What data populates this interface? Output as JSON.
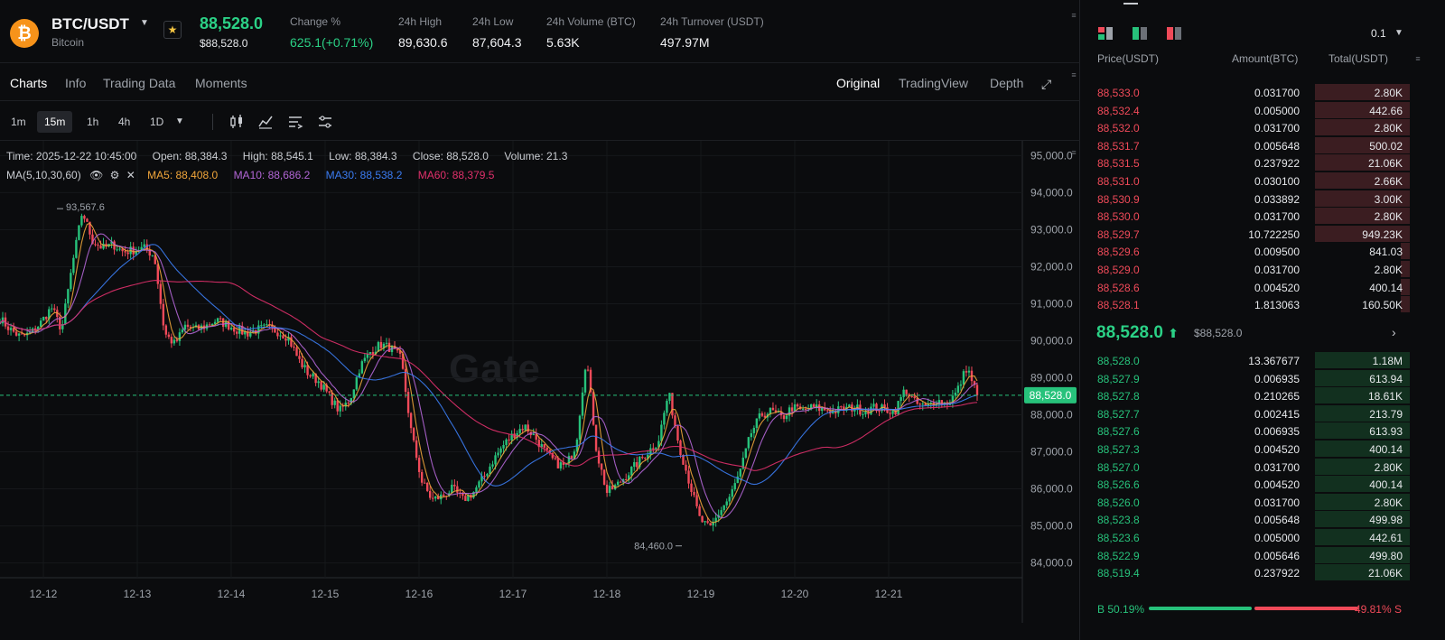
{
  "ticker": {
    "coin_glyph": "₿",
    "pair": "BTC/USDT",
    "name": "Bitcoin",
    "last_price": "88,528.0",
    "last_price_usd": "$88,528.0",
    "stats": [
      {
        "label": "Change %",
        "value": "625.1(+0.71%)",
        "color": "#2bd186"
      },
      {
        "label": "24h High",
        "value": "89,630.6"
      },
      {
        "label": "24h Low",
        "value": "87,604.3"
      },
      {
        "label": "24h Volume (BTC)",
        "value": "5.63K"
      },
      {
        "label": "24h Turnover (USDT)",
        "value": "497.97M"
      }
    ]
  },
  "tabs": {
    "left": [
      "Charts",
      "Info",
      "Trading Data",
      "Moments"
    ],
    "right": [
      "Original",
      "TradingView",
      "Depth"
    ]
  },
  "intervals": [
    "1m",
    "15m",
    "1h",
    "4h",
    "1D"
  ],
  "toolbar_icons": [
    "candlestick-icon",
    "indicator-icon",
    "settings-icon",
    "layout-icon"
  ],
  "chart_info": {
    "time": "Time: 2025-12-22 10:45:00",
    "open": "Open: 88,384.3",
    "high": "High: 88,545.1",
    "low": "Low: 88,384.3",
    "close": "Close: 88,528.0",
    "volume": "Volume: 21.3",
    "ma_label": "MA(5,10,30,60)",
    "ma5": "MA5: 88,408.0",
    "ma10": "MA10: 88,686.2",
    "ma30": "MA30: 88,538.2",
    "ma60": "MA60: 88,379.5"
  },
  "watermark": "Gate",
  "colors": {
    "up": "#27c27b",
    "down": "#f04a59",
    "ma5": "#f0a53a",
    "ma10": "#b266d6",
    "ma30": "#3b7cf2",
    "ma60": "#e0306b",
    "price_line": "#27c27b"
  },
  "chart_data": {
    "type": "candlestick",
    "ylim": [
      83600,
      95400
    ],
    "y_ticks": [
      95000,
      94000,
      93000,
      92000,
      91000,
      90000,
      89000,
      88000,
      87000,
      86000,
      85000,
      84000
    ],
    "y_tick_labels": [
      "95,000.0",
      "94,000.0",
      "93,000.0",
      "92,000.0",
      "91,000.0",
      "90,000.0",
      "89,000.0",
      "88,000.0",
      "87,000.0",
      "86,000.0",
      "85,000.0",
      "84,000.0"
    ],
    "x_tick_labels": [
      "12-12",
      "12-13",
      "12-14",
      "12-15",
      "12-16",
      "12-17",
      "12-18",
      "12-19",
      "12-20",
      "12-21"
    ],
    "current_price": 88528.0,
    "current_price_label": "88,528.0",
    "max_label": "93,567.6",
    "max_value": 93567.6,
    "min_label": "84,460.0",
    "min_value": 84460.0,
    "close_path": [
      {
        "date": "12-11",
        "price": 90600
      },
      {
        "date": "12-11",
        "price": 90300
      },
      {
        "date": "12-11",
        "price": 90100
      },
      {
        "date": "12-11",
        "price": 90200
      },
      {
        "date": "12-11",
        "price": 90500
      },
      {
        "date": "12-11",
        "price": 90900
      },
      {
        "date": "12-12",
        "price": 90300
      },
      {
        "date": "12-12",
        "price": 92000
      },
      {
        "date": "12-12",
        "price": 93500
      },
      {
        "date": "12-12",
        "price": 92700
      },
      {
        "date": "12-12",
        "price": 92500
      },
      {
        "date": "12-12",
        "price": 92600
      },
      {
        "date": "12-12",
        "price": 92400
      },
      {
        "date": "12-12",
        "price": 92450
      },
      {
        "date": "12-12",
        "price": 92500
      },
      {
        "date": "12-12",
        "price": 92300
      },
      {
        "date": "12-13",
        "price": 90200
      },
      {
        "date": "12-13",
        "price": 89900
      },
      {
        "date": "12-13",
        "price": 90400
      },
      {
        "date": "12-13",
        "price": 90300
      },
      {
        "date": "12-13",
        "price": 90400
      },
      {
        "date": "12-13",
        "price": 90550
      },
      {
        "date": "12-13",
        "price": 90450
      },
      {
        "date": "12-13",
        "price": 90300
      },
      {
        "date": "12-14",
        "price": 90200
      },
      {
        "date": "12-14",
        "price": 90300
      },
      {
        "date": "12-14",
        "price": 90350
      },
      {
        "date": "12-14",
        "price": 90250
      },
      {
        "date": "12-14",
        "price": 90100
      },
      {
        "date": "12-14",
        "price": 89500
      },
      {
        "date": "12-14",
        "price": 89100
      },
      {
        "date": "12-14",
        "price": 88900
      },
      {
        "date": "12-15",
        "price": 88500
      },
      {
        "date": "12-15",
        "price": 88100
      },
      {
        "date": "12-15",
        "price": 88400
      },
      {
        "date": "12-15",
        "price": 89300
      },
      {
        "date": "12-15",
        "price": 89700
      },
      {
        "date": "12-15",
        "price": 89900
      },
      {
        "date": "12-15",
        "price": 89800
      },
      {
        "date": "12-15",
        "price": 89500
      },
      {
        "date": "12-16",
        "price": 87500
      },
      {
        "date": "12-16",
        "price": 86200
      },
      {
        "date": "12-16",
        "price": 85700
      },
      {
        "date": "12-16",
        "price": 85800
      },
      {
        "date": "12-16",
        "price": 86000
      },
      {
        "date": "12-16",
        "price": 85700
      },
      {
        "date": "12-16",
        "price": 85900
      },
      {
        "date": "12-16",
        "price": 86300
      },
      {
        "date": "12-17",
        "price": 86800
      },
      {
        "date": "12-17",
        "price": 87200
      },
      {
        "date": "12-17",
        "price": 87500
      },
      {
        "date": "12-17",
        "price": 87700
      },
      {
        "date": "12-17",
        "price": 87400
      },
      {
        "date": "12-17",
        "price": 87000
      },
      {
        "date": "12-17",
        "price": 86700
      },
      {
        "date": "12-17",
        "price": 86600
      },
      {
        "date": "12-17",
        "price": 87200
      },
      {
        "date": "12-17",
        "price": 89600
      },
      {
        "date": "12-17",
        "price": 87000
      },
      {
        "date": "12-17",
        "price": 85900
      },
      {
        "date": "12-18",
        "price": 86100
      },
      {
        "date": "12-18",
        "price": 86400
      },
      {
        "date": "12-18",
        "price": 86700
      },
      {
        "date": "12-18",
        "price": 87000
      },
      {
        "date": "12-18",
        "price": 87300
      },
      {
        "date": "12-18",
        "price": 88600
      },
      {
        "date": "12-18",
        "price": 87200
      },
      {
        "date": "12-18",
        "price": 86200
      },
      {
        "date": "12-18",
        "price": 85200
      },
      {
        "date": "12-19",
        "price": 84900
      },
      {
        "date": "12-19",
        "price": 85400
      },
      {
        "date": "12-19",
        "price": 85800
      },
      {
        "date": "12-19",
        "price": 86500
      },
      {
        "date": "12-19",
        "price": 87500
      },
      {
        "date": "12-19",
        "price": 88000
      },
      {
        "date": "12-19",
        "price": 88100
      },
      {
        "date": "12-19",
        "price": 87900
      },
      {
        "date": "12-20",
        "price": 88200
      },
      {
        "date": "12-20",
        "price": 88100
      },
      {
        "date": "12-20",
        "price": 88200
      },
      {
        "date": "12-20",
        "price": 88150
      },
      {
        "date": "12-20",
        "price": 88100
      },
      {
        "date": "12-20",
        "price": 88150
      },
      {
        "date": "12-20",
        "price": 88200
      },
      {
        "date": "12-20",
        "price": 88100
      },
      {
        "date": "12-21",
        "price": 88200
      },
      {
        "date": "12-21",
        "price": 88150
      },
      {
        "date": "12-21",
        "price": 88100
      },
      {
        "date": "12-21",
        "price": 88700
      },
      {
        "date": "12-21",
        "price": 88300
      },
      {
        "date": "12-21",
        "price": 88200
      },
      {
        "date": "12-21",
        "price": 88400
      },
      {
        "date": "12-21",
        "price": 88300
      },
      {
        "date": "12-21",
        "price": 88600
      },
      {
        "date": "12-22",
        "price": 89300
      },
      {
        "date": "12-22",
        "price": 88528
      }
    ]
  },
  "orderbook": {
    "headers": {
      "price": "Price(USDT)",
      "amount": "Amount(BTC)",
      "total": "Total(USDT)"
    },
    "precision": "0.1",
    "asks": [
      {
        "price": "88,533.0",
        "amount": "0.031700",
        "total": "2.80K",
        "depth": 0.42
      },
      {
        "price": "88,532.4",
        "amount": "0.005000",
        "total": "442.66",
        "depth": 0.42
      },
      {
        "price": "88,532.0",
        "amount": "0.031700",
        "total": "2.80K",
        "depth": 0.42
      },
      {
        "price": "88,531.7",
        "amount": "0.005648",
        "total": "500.02",
        "depth": 0.42
      },
      {
        "price": "88,531.5",
        "amount": "0.237922",
        "total": "21.06K",
        "depth": 0.42
      },
      {
        "price": "88,531.0",
        "amount": "0.030100",
        "total": "2.66K",
        "depth": 0.42
      },
      {
        "price": "88,530.9",
        "amount": "0.033892",
        "total": "3.00K",
        "depth": 0.42
      },
      {
        "price": "88,530.0",
        "amount": "0.031700",
        "total": "2.80K",
        "depth": 0.42
      },
      {
        "price": "88,529.7",
        "amount": "10.722250",
        "total": "949.23K",
        "depth": 0.42
      },
      {
        "price": "88,529.6",
        "amount": "0.009500",
        "total": "841.03",
        "depth": 0.04
      },
      {
        "price": "88,529.0",
        "amount": "0.031700",
        "total": "2.80K",
        "depth": 0.04
      },
      {
        "price": "88,528.6",
        "amount": "0.004520",
        "total": "400.14",
        "depth": 0.04
      },
      {
        "price": "88,528.1",
        "amount": "1.813063",
        "total": "160.50K",
        "depth": 0.04
      }
    ],
    "mid": {
      "price": "88,528.0",
      "arrow": "⬆",
      "usd": "$88,528.0",
      "chevron": "›"
    },
    "bids": [
      {
        "price": "88,528.0",
        "amount": "13.367677",
        "total": "1.18M",
        "depth": 0.42
      },
      {
        "price": "88,527.9",
        "amount": "0.006935",
        "total": "613.94",
        "depth": 0.42
      },
      {
        "price": "88,527.8",
        "amount": "0.210265",
        "total": "18.61K",
        "depth": 0.42
      },
      {
        "price": "88,527.7",
        "amount": "0.002415",
        "total": "213.79",
        "depth": 0.42
      },
      {
        "price": "88,527.6",
        "amount": "0.006935",
        "total": "613.93",
        "depth": 0.42
      },
      {
        "price": "88,527.3",
        "amount": "0.004520",
        "total": "400.14",
        "depth": 0.42
      },
      {
        "price": "88,527.0",
        "amount": "0.031700",
        "total": "2.80K",
        "depth": 0.42
      },
      {
        "price": "88,526.6",
        "amount": "0.004520",
        "total": "400.14",
        "depth": 0.42
      },
      {
        "price": "88,526.0",
        "amount": "0.031700",
        "total": "2.80K",
        "depth": 0.42
      },
      {
        "price": "88,523.8",
        "amount": "0.005648",
        "total": "499.98",
        "depth": 0.42
      },
      {
        "price": "88,523.6",
        "amount": "0.005000",
        "total": "442.61",
        "depth": 0.42
      },
      {
        "price": "88,522.9",
        "amount": "0.005646",
        "total": "499.80",
        "depth": 0.42
      },
      {
        "price": "88,519.4",
        "amount": "0.237922",
        "total": "21.06K",
        "depth": 0.42
      }
    ],
    "buy_ratio": "B 50.19%",
    "sell_ratio": "49.81% S",
    "buy_fraction": 0.5019
  }
}
